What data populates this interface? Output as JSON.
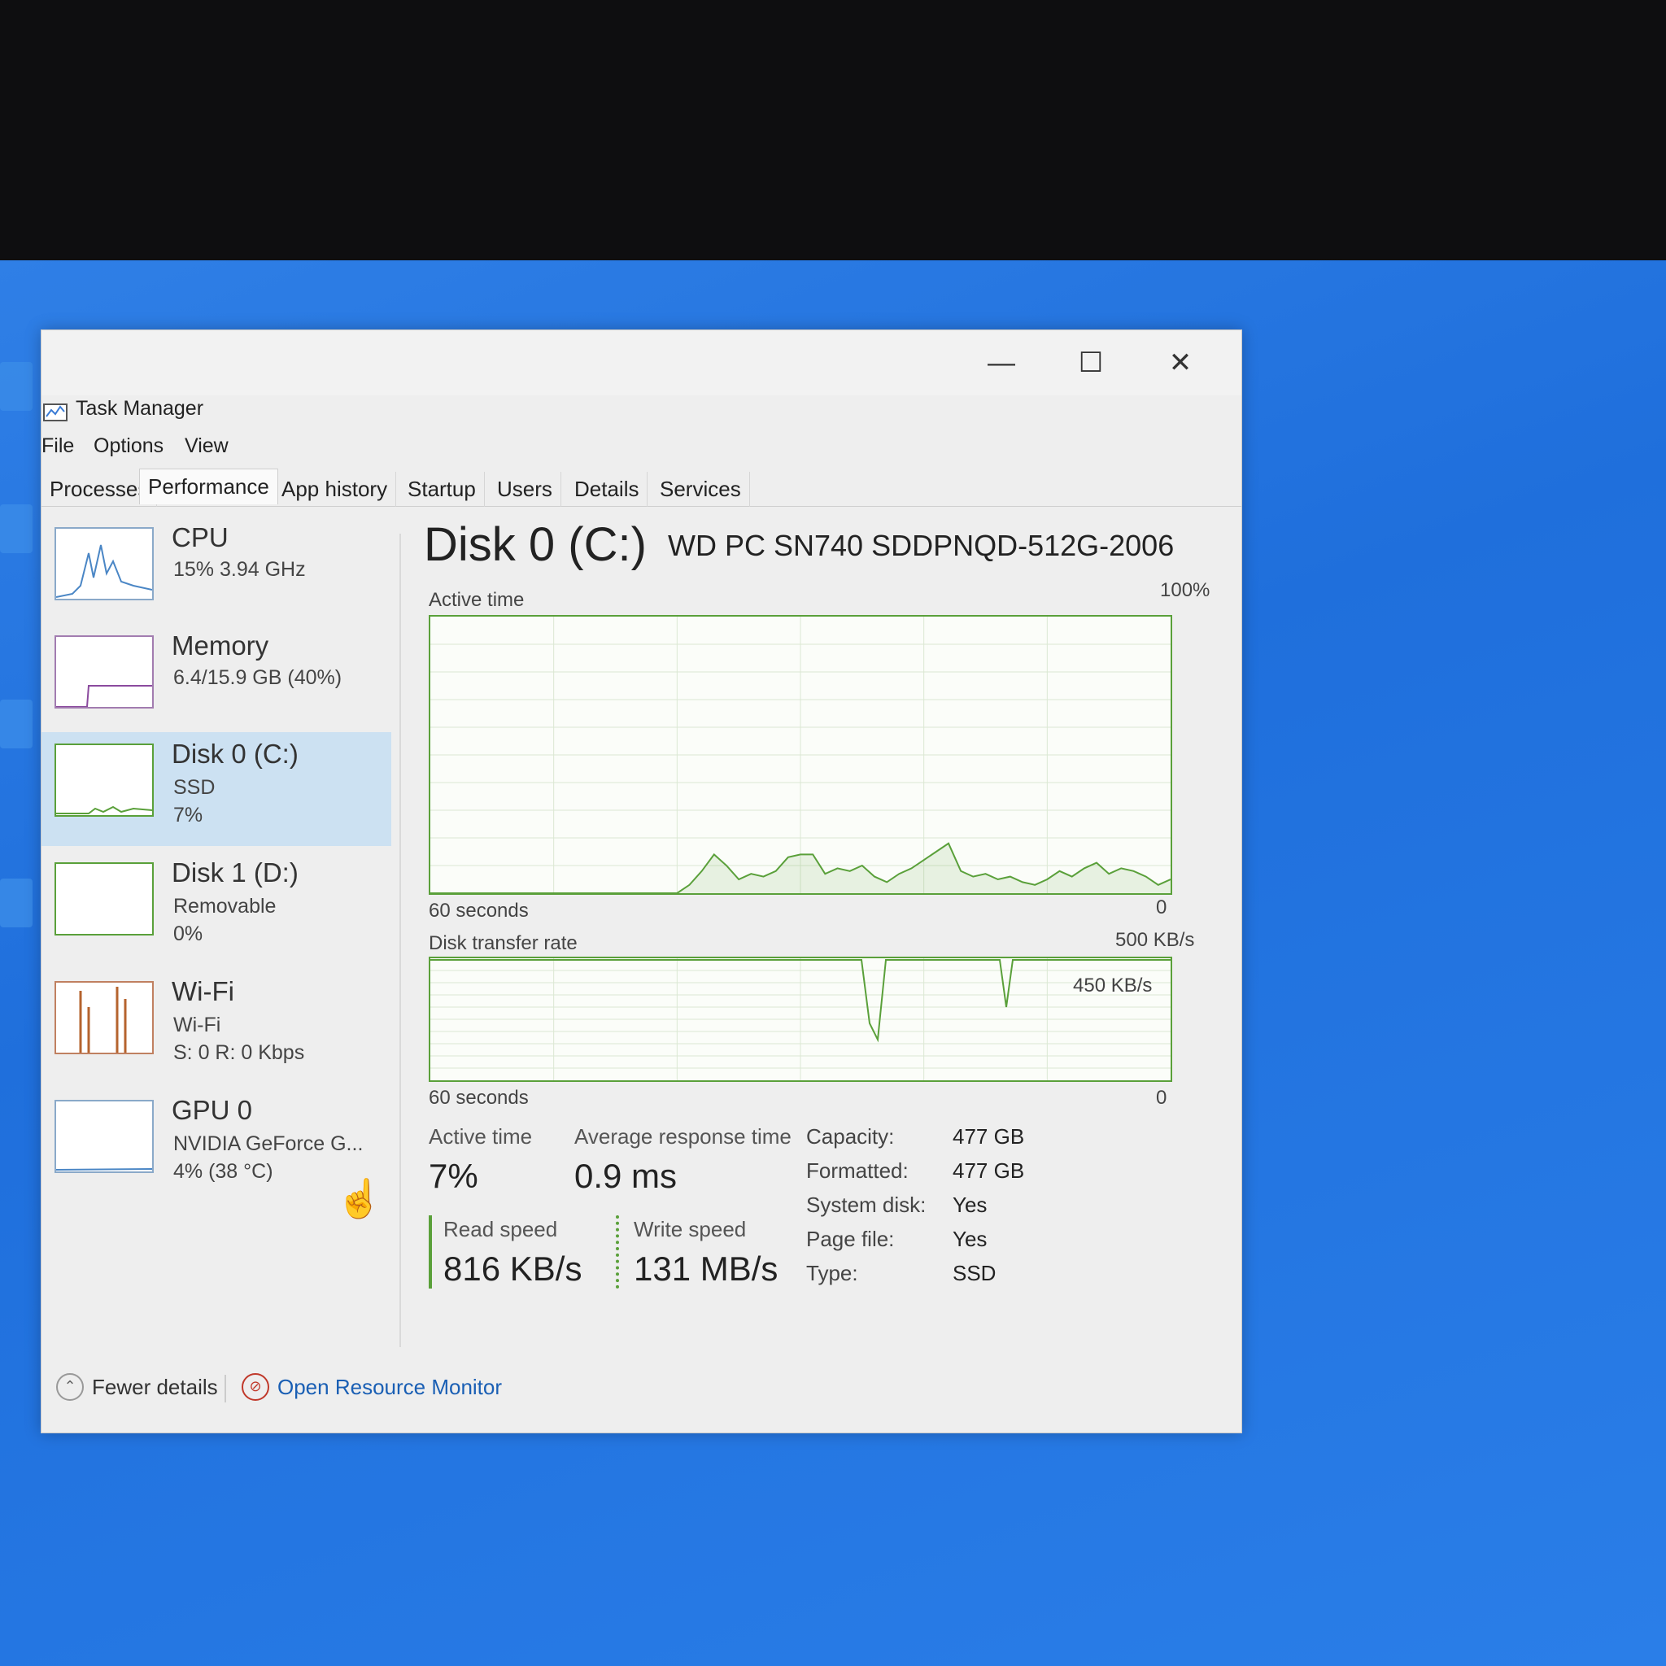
{
  "window": {
    "title": "Task Manager",
    "controls": {
      "minimize": "—",
      "maximize": "☐",
      "close": "✕"
    }
  },
  "menu": [
    "File",
    "Options",
    "View"
  ],
  "tabs": [
    {
      "label": "Processes",
      "active": false
    },
    {
      "label": "Performance",
      "active": true
    },
    {
      "label": "App history",
      "active": false
    },
    {
      "label": "Startup",
      "active": false
    },
    {
      "label": "Users",
      "active": false
    },
    {
      "label": "Details",
      "active": false
    },
    {
      "label": "Services",
      "active": false
    }
  ],
  "sidebar": [
    {
      "name": "CPU",
      "line1": "15% 3.94 GHz",
      "line2": "",
      "color": "#4a86c5"
    },
    {
      "name": "Memory",
      "line1": "6.4/15.9 GB (40%)",
      "line2": "",
      "color": "#8b4a9e"
    },
    {
      "name": "Disk 0 (C:)",
      "line1": "SSD",
      "line2": "7%",
      "color": "#5aa03a",
      "selected": true
    },
    {
      "name": "Disk 1 (D:)",
      "line1": "Removable",
      "line2": "0%",
      "color": "#5aa03a"
    },
    {
      "name": "Wi-Fi",
      "line1": "Wi-Fi",
      "line2": "S: 0 R: 0 Kbps",
      "color": "#b5632e"
    },
    {
      "name": "GPU 0",
      "line1": "NVIDIA GeForce G...",
      "line2": "4% (38 °C)",
      "color": "#4a86c5"
    }
  ],
  "detail": {
    "title": "Disk 0 (C:)",
    "model": "WD PC SN740 SDDPNQD-512G-2006",
    "graph1": {
      "label": "Active time",
      "max": "100%",
      "xlabel": "60 seconds",
      "min": "0"
    },
    "graph2": {
      "label": "Disk transfer rate",
      "max": "500 KB/s",
      "mark": "450 KB/s",
      "xlabel": "60 seconds",
      "min": "0"
    },
    "stats": {
      "active_time_label": "Active time",
      "active_time": "7%",
      "resp_label": "Average response time",
      "resp": "0.9 ms",
      "read_label": "Read speed",
      "read": "816 KB/s",
      "write_label": "Write speed",
      "write": "131 MB/s"
    },
    "props": [
      {
        "key": "Capacity:",
        "val": "477 GB"
      },
      {
        "key": "Formatted:",
        "val": "477 GB"
      },
      {
        "key": "System disk:",
        "val": "Yes"
      },
      {
        "key": "Page file:",
        "val": "Yes"
      },
      {
        "key": "Type:",
        "val": "SSD"
      }
    ]
  },
  "footer": {
    "fewer": "Fewer details",
    "monitor": "Open Resource Monitor"
  },
  "chart_data": {
    "type": "line",
    "title": "Active time",
    "ylim": [
      0,
      100
    ],
    "x_span_seconds": 60,
    "values": [
      0,
      0,
      0,
      0,
      0,
      0,
      0,
      0,
      0,
      0,
      0,
      0,
      0,
      0,
      0,
      0,
      0,
      0,
      0,
      0,
      0,
      3,
      8,
      14,
      10,
      5,
      7,
      6,
      8,
      13,
      14,
      14,
      7,
      9,
      8,
      10,
      6,
      4,
      7,
      9,
      12,
      15,
      18,
      8,
      6,
      7,
      5,
      6,
      4,
      3,
      5,
      8,
      6,
      9,
      11,
      7,
      9,
      8,
      6,
      3,
      5
    ]
  },
  "colors": {
    "accent_green": "#5aa03a",
    "selected_bg": "#cce1f2",
    "link": "#1a5fb4"
  }
}
